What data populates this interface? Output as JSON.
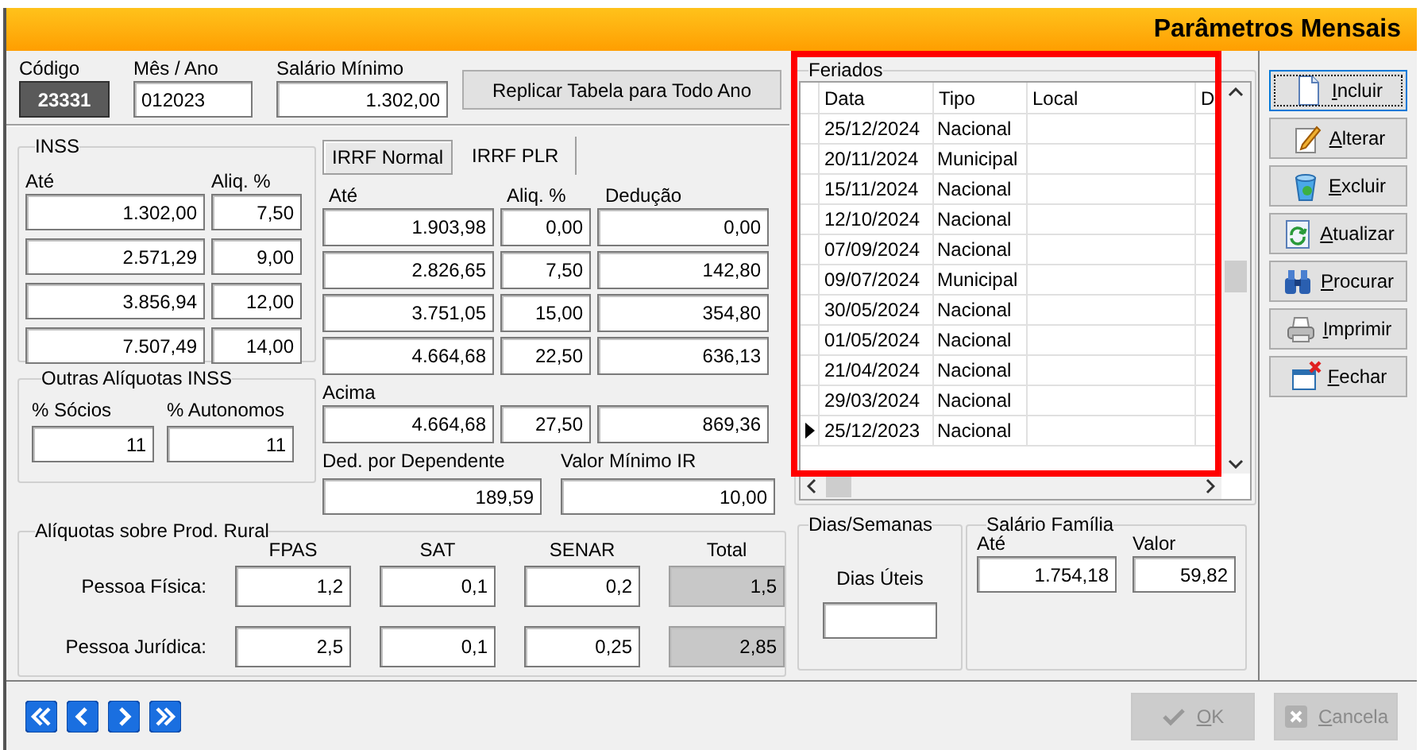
{
  "window": {
    "title": "Parâmetros Mensais"
  },
  "top_fields": [
    {
      "label": "Código",
      "value": "23331",
      "kind": "readonly"
    },
    {
      "label": "Mês / Ano",
      "value": "012023",
      "kind": "text"
    },
    {
      "label": "Salário Mínimo",
      "value": "1.302,00",
      "kind": "number"
    }
  ],
  "replicate_button": "Replicar Tabela para Todo Ano",
  "inss": {
    "title": "INSS",
    "columns": [
      "Até",
      "Aliq. %"
    ],
    "rows": [
      [
        "1.302,00",
        "7,50"
      ],
      [
        "2.571,29",
        "9,00"
      ],
      [
        "3.856,94",
        "12,00"
      ],
      [
        "7.507,49",
        "14,00"
      ]
    ]
  },
  "outras_aliquotas": {
    "title": "Outras Alíquotas INSS",
    "fields": [
      {
        "label": "% Sócios",
        "value": "11"
      },
      {
        "label": "% Autonomos",
        "value": "11"
      }
    ]
  },
  "irrf_tabs": [
    {
      "label": "IRRF Normal",
      "selected": true
    },
    {
      "label": "IRRF PLR",
      "selected": false
    }
  ],
  "irrf": {
    "columns": [
      "Até",
      "Aliq. %",
      "Dedução"
    ],
    "rows": [
      [
        "1.903,98",
        "0,00",
        "0,00"
      ],
      [
        "2.826,65",
        "7,50",
        "142,80"
      ],
      [
        "3.751,05",
        "15,00",
        "354,80"
      ],
      [
        "4.664,68",
        "22,50",
        "636,13"
      ]
    ],
    "above_label": "Acima",
    "above_row": [
      "4.664,68",
      "27,50",
      "869,36"
    ],
    "extra_fields": [
      {
        "label": "Ded. por Dependente",
        "value": "189,59"
      },
      {
        "label": "Valor Mínimo IR",
        "value": "10,00"
      }
    ]
  },
  "prod_rural": {
    "title": "Alíquotas sobre Prod. Rural",
    "columns": [
      "FPAS",
      "SAT",
      "SENAR",
      "Total"
    ],
    "rows": [
      {
        "label": "Pessoa Física:",
        "values": [
          "1,2",
          "0,1",
          "0,2"
        ],
        "total": "1,5"
      },
      {
        "label": "Pessoa Jurídica:",
        "values": [
          "2,5",
          "0,1",
          "0,25"
        ],
        "total": "2,85"
      }
    ]
  },
  "feriados": {
    "title": "Feriados",
    "columns": [
      "Data",
      "Tipo",
      "Local",
      "D"
    ],
    "rows": [
      {
        "data": "25/12/2024",
        "tipo": "Nacional",
        "selected": false
      },
      {
        "data": "20/11/2024",
        "tipo": "Municipal",
        "selected": false
      },
      {
        "data": "15/11/2024",
        "tipo": "Nacional",
        "selected": false
      },
      {
        "data": "12/10/2024",
        "tipo": "Nacional",
        "selected": false
      },
      {
        "data": "07/09/2024",
        "tipo": "Nacional",
        "selected": false
      },
      {
        "data": "09/07/2024",
        "tipo": "Municipal",
        "selected": false
      },
      {
        "data": "30/05/2024",
        "tipo": "Nacional",
        "selected": false
      },
      {
        "data": "01/05/2024",
        "tipo": "Nacional",
        "selected": false
      },
      {
        "data": "21/04/2024",
        "tipo": "Nacional",
        "selected": false
      },
      {
        "data": "29/03/2024",
        "tipo": "Nacional",
        "selected": false
      },
      {
        "data": "25/12/2023",
        "tipo": "Nacional",
        "selected": true
      }
    ]
  },
  "dias_semanas": {
    "title": "Dias/Semanas",
    "label": "Dias Úteis"
  },
  "salario_familia": {
    "title": "Salário Família",
    "fields": [
      {
        "label": "Até",
        "value": "1.754,18"
      },
      {
        "label": "Valor",
        "value": "59,82"
      }
    ]
  },
  "side_buttons": [
    {
      "label": "Incluir",
      "kind": "new",
      "focused": true
    },
    {
      "label": "Alterar",
      "kind": "edit",
      "focused": false
    },
    {
      "label": "Excluir",
      "kind": "delete",
      "focused": false
    },
    {
      "label": "Atualizar",
      "kind": "refresh",
      "focused": false
    },
    {
      "label": "Procurar",
      "kind": "search",
      "focused": false
    },
    {
      "label": "Imprimir",
      "kind": "print",
      "focused": false
    },
    {
      "label": "Fechar",
      "kind": "close",
      "focused": false
    }
  ],
  "nav_buttons": [
    {
      "kind": "first"
    },
    {
      "kind": "prev"
    },
    {
      "kind": "next"
    },
    {
      "kind": "last"
    }
  ],
  "footer_buttons": [
    {
      "label": "OK",
      "kind": "ok",
      "disabled": true
    },
    {
      "label": "Cancela",
      "kind": "cancel",
      "disabled": true
    }
  ]
}
